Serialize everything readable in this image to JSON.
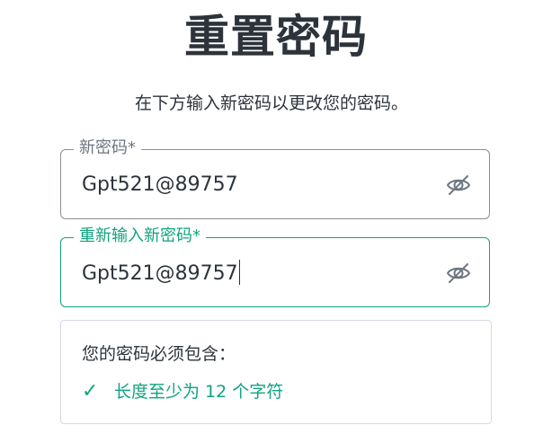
{
  "page": {
    "title": "重置密码",
    "subtitle": "在下方输入新密码以更改您的密码。"
  },
  "new_password": {
    "label": "新密码*",
    "value": "Gpt521@89757",
    "toggle_icon": "eye-slash-icon"
  },
  "confirm_password": {
    "label": "重新输入新密码*",
    "value": "Gpt521@89757",
    "toggle_icon": "eye-slash-icon"
  },
  "requirements": {
    "title": "您的密码必须包含：",
    "items": [
      {
        "text": "长度至少为 12 个字符",
        "met": true,
        "icon": "check-icon"
      }
    ]
  },
  "colors": {
    "accent": "#10a37f",
    "text": "#2d333a",
    "border": "#8a8f98",
    "label_gray": "#6e7681"
  }
}
